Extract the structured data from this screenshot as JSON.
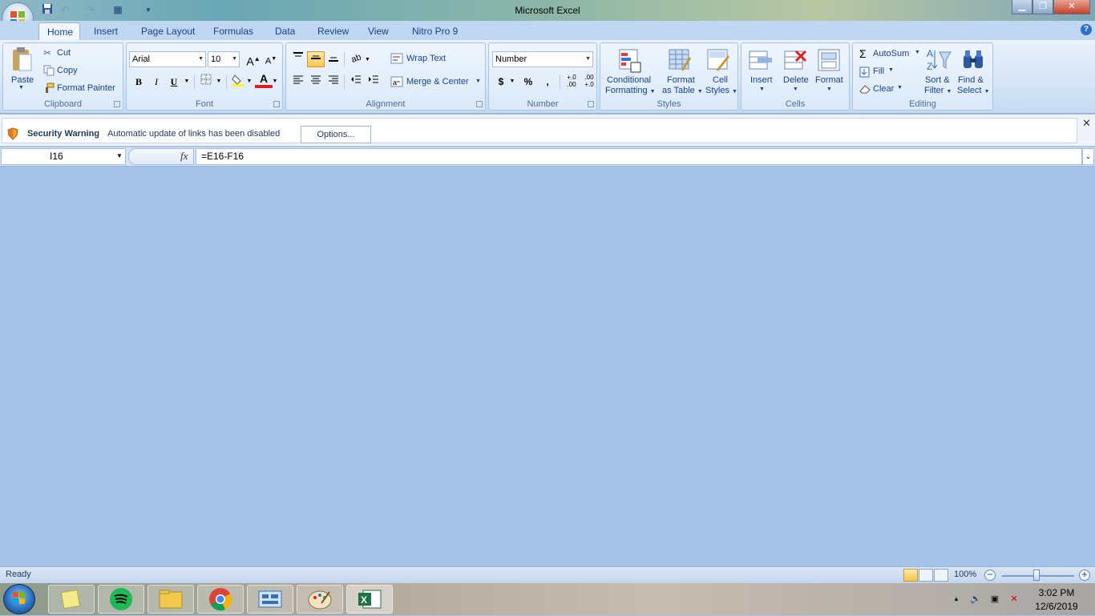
{
  "window": {
    "title": "Microsoft Excel"
  },
  "tabs": [
    "Home",
    "Insert",
    "Page Layout",
    "Formulas",
    "Data",
    "Review",
    "View",
    "Nitro Pro 9"
  ],
  "ribbon": {
    "clipboard": {
      "label": "Clipboard",
      "paste": "Paste",
      "cut": "Cut",
      "copy": "Copy",
      "format_painter": "Format Painter"
    },
    "font": {
      "label": "Font",
      "family": "Arial",
      "size": "10",
      "bold": "B",
      "italic": "I",
      "underline": "U",
      "grow": "A",
      "shrink": "A"
    },
    "alignment": {
      "label": "Alignment",
      "wrap_text": "Wrap Text",
      "merge_center": "Merge & Center"
    },
    "number": {
      "label": "Number",
      "format": "Number",
      "currency": "$",
      "percent": "%",
      "comma": ",",
      "inc_decimal": "+.0 .00",
      "dec_decimal": ".00 +.0"
    },
    "styles": {
      "label": "Styles",
      "conditional_1": "Conditional",
      "conditional_2": "Formatting",
      "format_table_1": "Format",
      "format_table_2": "as Table",
      "cell_styles_1": "Cell",
      "cell_styles_2": "Styles"
    },
    "cells": {
      "label": "Cells",
      "insert": "Insert",
      "delete": "Delete",
      "format": "Format"
    },
    "editing": {
      "label": "Editing",
      "autosum": "AutoSum",
      "fill": "Fill",
      "clear": "Clear",
      "sort_1": "Sort &",
      "sort_2": "Filter",
      "find_1": "Find &",
      "find_2": "Select"
    }
  },
  "security": {
    "title": "Security Warning",
    "message": "Automatic update of links has been disabled",
    "options": "Options..."
  },
  "formula_bar": {
    "name_box": "I16",
    "fx": "fx",
    "formula": "=E16-F16"
  },
  "status": {
    "ready": "Ready",
    "zoom": "100%"
  },
  "clock": {
    "time": "3:02 PM",
    "date": "12/6/2019"
  },
  "colors": {
    "accent": "#15428b",
    "workspace": "#a5c3e8",
    "selected": "#f9c54b"
  }
}
